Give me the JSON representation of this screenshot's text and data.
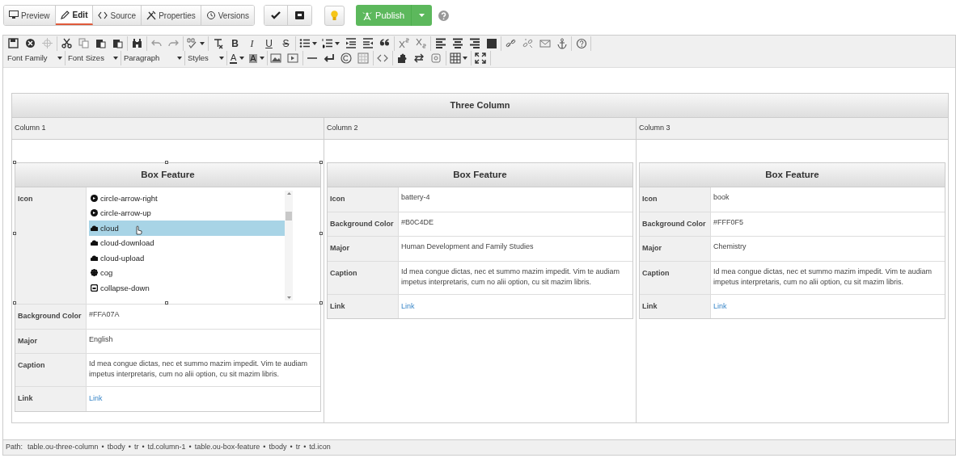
{
  "view_tabs": [
    {
      "label": "Preview",
      "selected": false
    },
    {
      "label": "Edit",
      "selected": true
    },
    {
      "label": "Source",
      "selected": false
    },
    {
      "label": "Properties",
      "selected": false
    },
    {
      "label": "Versions",
      "selected": false
    }
  ],
  "publish": {
    "label": "Publish"
  },
  "editor_toolbar": {
    "glyphs": [
      "B",
      "I",
      "U",
      "S"
    ],
    "color_glyphs": [
      "A",
      "A"
    ],
    "dropdowns": [
      "Font Family",
      "Font Sizes",
      "Paragraph",
      "Styles"
    ]
  },
  "table": {
    "title": "Three Column",
    "columns": [
      "Column 1",
      "Column 2",
      "Column 3"
    ],
    "boxes": [
      {
        "title": "Box Feature",
        "rows": [
          {
            "kind": "list",
            "label": "Icon",
            "options": [
              {
                "label": "circle-arrow-right",
                "selected": false
              },
              {
                "label": "circle-arrow-up",
                "selected": false
              },
              {
                "label": "cloud",
                "selected": true
              },
              {
                "label": "cloud-download",
                "selected": false
              },
              {
                "label": "cloud-upload",
                "selected": false
              },
              {
                "label": "cog",
                "selected": false
              },
              {
                "label": "collapse-down",
                "selected": false
              }
            ]
          },
          {
            "kind": "text",
            "label": "Background Color",
            "value": "#FFA07A"
          },
          {
            "kind": "text",
            "label": "Major",
            "value": "English"
          },
          {
            "kind": "text",
            "label": "Caption",
            "value": "Id mea congue dictas, nec et summo mazim impedit. Vim te audiam impetus interpretaris, cum no alii option, cu sit mazim libris."
          },
          {
            "kind": "link",
            "label": "Link",
            "value": "Link"
          }
        ]
      },
      {
        "title": "Box Feature",
        "rows": [
          {
            "kind": "text",
            "label": "Icon",
            "value": "battery-4"
          },
          {
            "kind": "text",
            "label": "Background Color",
            "value": "#B0C4DE"
          },
          {
            "kind": "text",
            "label": "Major",
            "value": "Human Development and Family Studies"
          },
          {
            "kind": "text",
            "label": "Caption",
            "value": "Id mea congue dictas, nec et summo mazim impedit. Vim te audiam impetus interpretaris, cum no alii option, cu sit mazim libris."
          },
          {
            "kind": "link",
            "label": "Link",
            "value": "Link"
          }
        ]
      },
      {
        "title": "Box Feature",
        "rows": [
          {
            "kind": "text",
            "label": "Icon",
            "value": "book"
          },
          {
            "kind": "text",
            "label": "Background Color",
            "value": "#FFF0F5"
          },
          {
            "kind": "text",
            "label": "Major",
            "value": "Chemistry"
          },
          {
            "kind": "text",
            "label": "Caption",
            "value": "Id mea congue dictas, nec et summo mazim impedit. Vim te audiam impetus interpretaris, cum no alii option, cu sit mazim libris."
          },
          {
            "kind": "link",
            "label": "Link",
            "value": "Link"
          }
        ]
      }
    ]
  },
  "path_bar": {
    "label": "Path:",
    "separator": "•",
    "items": [
      "table.ou-three-column",
      "tbody",
      "tr",
      "td.column-1",
      "table.ou-box-feature",
      "tbody",
      "tr",
      "td.icon"
    ]
  }
}
